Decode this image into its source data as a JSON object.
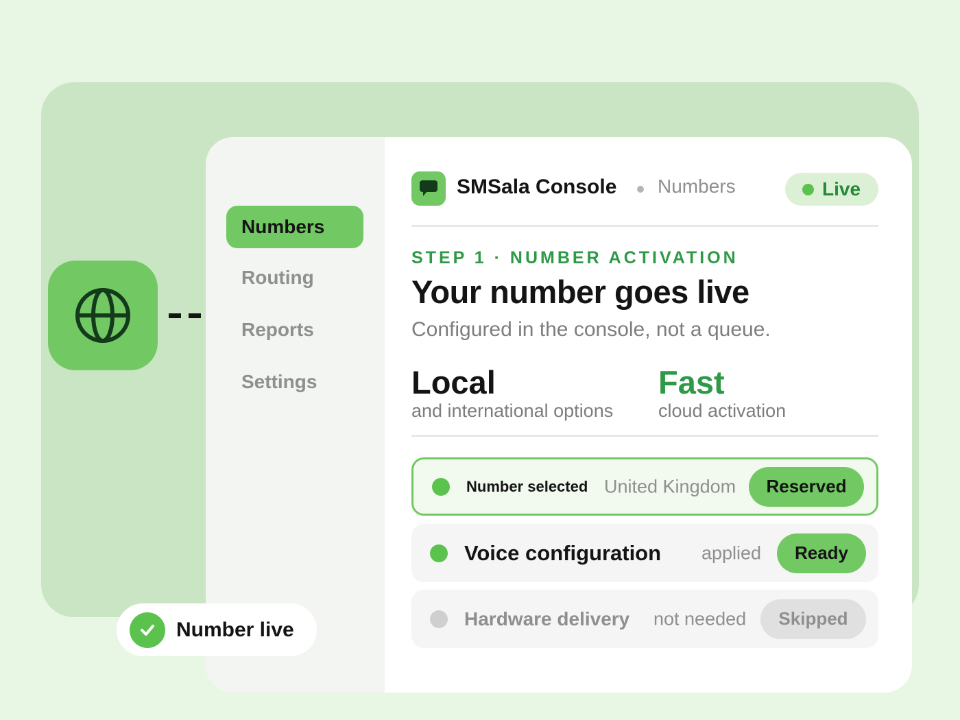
{
  "colors": {
    "brand_green": "#72c963",
    "accent_text_green": "#2e9946",
    "background": "#e8f6e4"
  },
  "hero_icon": "globe-icon",
  "sidebar": {
    "items": [
      {
        "label": "Numbers",
        "active": true
      },
      {
        "label": "Routing",
        "active": false
      },
      {
        "label": "Reports",
        "active": false
      },
      {
        "label": "Settings",
        "active": false
      }
    ]
  },
  "header": {
    "app_icon": "chat-bubble-icon",
    "title": "SMSala Console",
    "breadcrumb": "Numbers",
    "status": "Live"
  },
  "main": {
    "eyebrow": "STEP 1 · NUMBER ACTIVATION",
    "headline": "Your number goes live",
    "subheadline": "Configured in the console, not a queue.",
    "stats": [
      {
        "value": "Local",
        "caption": "and international options"
      },
      {
        "value": "Fast",
        "caption": "cloud activation"
      }
    ]
  },
  "steps": [
    {
      "title": "Number selected",
      "note": "United Kingdom",
      "badge": "Reserved",
      "state": "selected"
    },
    {
      "title": "Voice configuration",
      "note": "applied",
      "badge": "Ready",
      "state": "done"
    },
    {
      "title": "Hardware delivery",
      "note": "not needed",
      "badge": "Skipped",
      "state": "skipped"
    }
  ],
  "toast": {
    "icon": "check-icon",
    "label": "Number live"
  }
}
